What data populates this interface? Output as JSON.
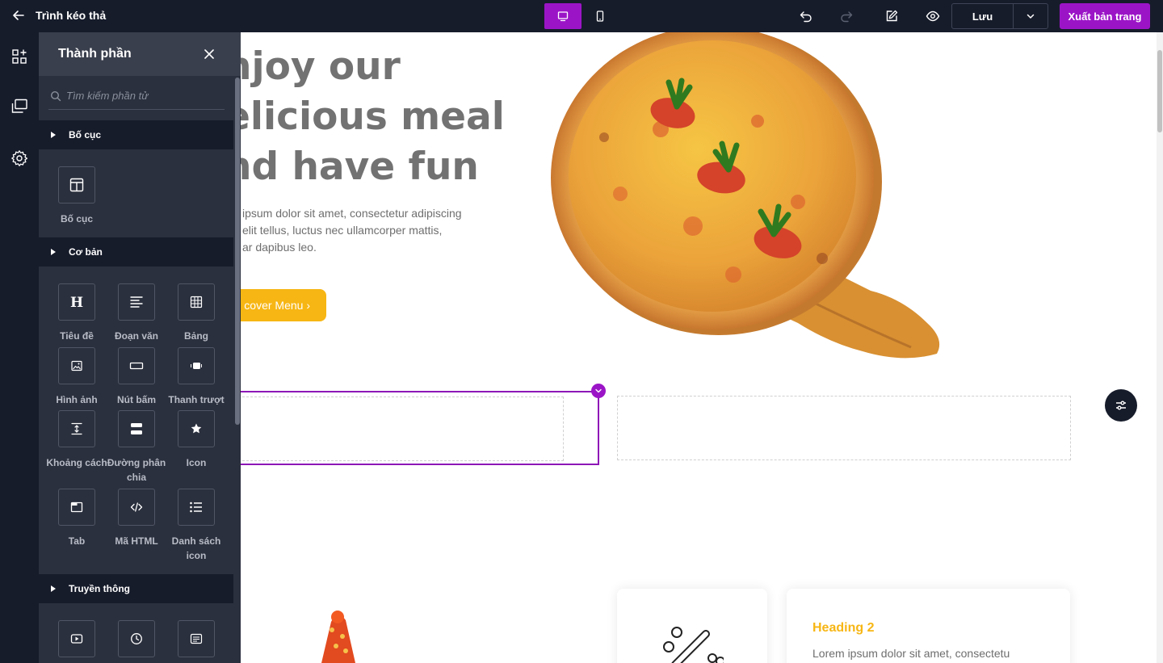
{
  "app": {
    "title": "Trình kéo thả"
  },
  "toolbar": {
    "save_label": "Lưu",
    "publish_label": "Xuất bản trang",
    "accent_color": "#9b15c7",
    "icons": [
      "back-arrow-icon",
      "desktop-icon",
      "mobile-icon",
      "undo-icon",
      "redo-icon",
      "edit-icon",
      "eye-icon",
      "chevron-down-icon"
    ]
  },
  "rail": {
    "icons": [
      "components-icon",
      "pages-icon",
      "gear-icon"
    ]
  },
  "panel": {
    "title": "Thành phần",
    "search": {
      "placeholder": "Tìm kiếm phần tử",
      "value": ""
    },
    "sections": [
      {
        "label": "Bố cục",
        "items": [
          {
            "label": "Bố cục",
            "icon": "layout-icon"
          }
        ]
      },
      {
        "label": "Cơ bản",
        "items": [
          {
            "label": "Tiêu đề",
            "icon": "heading-icon"
          },
          {
            "label": "Đoạn văn",
            "icon": "paragraph-icon"
          },
          {
            "label": "Bảng",
            "icon": "table-icon"
          },
          {
            "label": "Hình ảnh",
            "icon": "image-icon"
          },
          {
            "label": "Nút bấm",
            "icon": "button-icon"
          },
          {
            "label": "Thanh trượt",
            "icon": "slider-icon"
          },
          {
            "label": "Khoảng cách",
            "icon": "spacer-icon"
          },
          {
            "label": "Đường phân chia",
            "icon": "divider-icon"
          },
          {
            "label": "Icon",
            "icon": "star-icon"
          },
          {
            "label": "Tab",
            "icon": "tab-icon"
          },
          {
            "label": "Mã HTML",
            "icon": "code-icon"
          },
          {
            "label": "Danh sách icon",
            "icon": "icon-list-icon"
          }
        ]
      },
      {
        "label": "Truyền thông",
        "items": [
          {
            "label": "",
            "icon": "video-icon"
          },
          {
            "label": "",
            "icon": "clock-icon"
          },
          {
            "label": "",
            "icon": "text-box-icon"
          }
        ]
      }
    ]
  },
  "canvas": {
    "hero": {
      "heading_lines": [
        "njoy our",
        "elicious meal",
        "nd have fun"
      ],
      "body_lines": [
        "ipsum dolor sit amet, consectetur adipiscing",
        "elit tellus, luctus nec ullamcorper mattis,",
        "ar dapibus leo."
      ],
      "cta_label": "cover Menu  ›"
    },
    "card": {
      "heading": "Heading 2",
      "text": "Lorem ipsum dolor sit amet, consectetu"
    },
    "colors": {
      "cta": "#f7b614",
      "heading_text": "#727272"
    }
  }
}
